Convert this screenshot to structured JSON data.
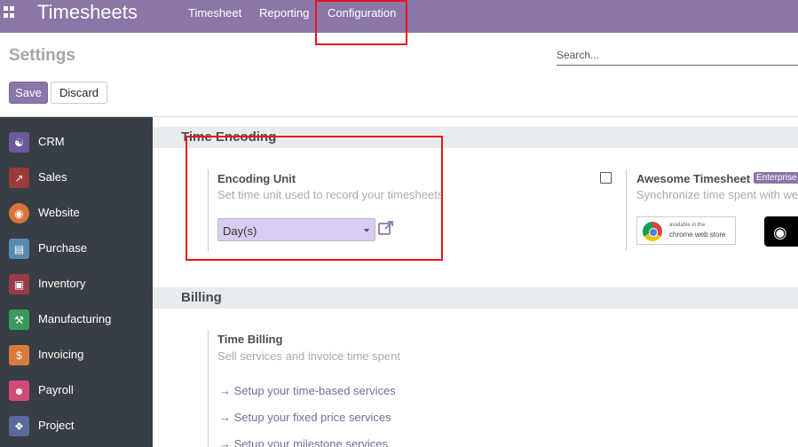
{
  "navbar": {
    "brand": "Timesheets",
    "menu": [
      "Timesheet",
      "Reporting",
      "Configuration"
    ]
  },
  "control_panel": {
    "title": "Settings",
    "search_placeholder": "Search...",
    "save_label": "Save",
    "discard_label": "Discard"
  },
  "sidebar": {
    "items": [
      {
        "label": "CRM",
        "icon": "handshake-icon",
        "color": "#6c5a9a"
      },
      {
        "label": "Sales",
        "icon": "chart-icon",
        "color": "#9a3a3a"
      },
      {
        "label": "Website",
        "icon": "globe-icon",
        "color": "#d8743a"
      },
      {
        "label": "Purchase",
        "icon": "card-icon",
        "color": "#5a8ab0"
      },
      {
        "label": "Inventory",
        "icon": "box-icon",
        "color": "#9a3a4a"
      },
      {
        "label": "Manufacturing",
        "icon": "wrench-icon",
        "color": "#3a9a5a"
      },
      {
        "label": "Invoicing",
        "icon": "invoice-icon",
        "color": "#d87a3a"
      },
      {
        "label": "Payroll",
        "icon": "person-icon",
        "color": "#d04a7a"
      },
      {
        "label": "Project",
        "icon": "puzzle-icon",
        "color": "#5a6a9a"
      }
    ]
  },
  "time_encoding": {
    "section_title": "Time Encoding",
    "encoding_unit": {
      "title": "Encoding Unit",
      "description": "Set time unit used to record your timesheets",
      "selected": "Day(s)"
    },
    "awesome": {
      "title": "Awesome Timesheet",
      "badge": "Enterprise",
      "description": "Synchronize time spent with web/mobile app",
      "chrome_line1": "available in the",
      "chrome_line2": "chrome web store",
      "checked": false
    }
  },
  "billing": {
    "section_title": "Billing",
    "time_billing": {
      "title": "Time Billing",
      "description": "Sell services and invoice time spent",
      "links": [
        "Setup your time-based services",
        "Setup your fixed price services",
        "Setup your milestone services"
      ]
    }
  },
  "colors": {
    "brand": "#8a77a8",
    "sidebar_bg": "#383e45",
    "annotation": "#e8141c",
    "select_bg": "#d8ccf3"
  }
}
